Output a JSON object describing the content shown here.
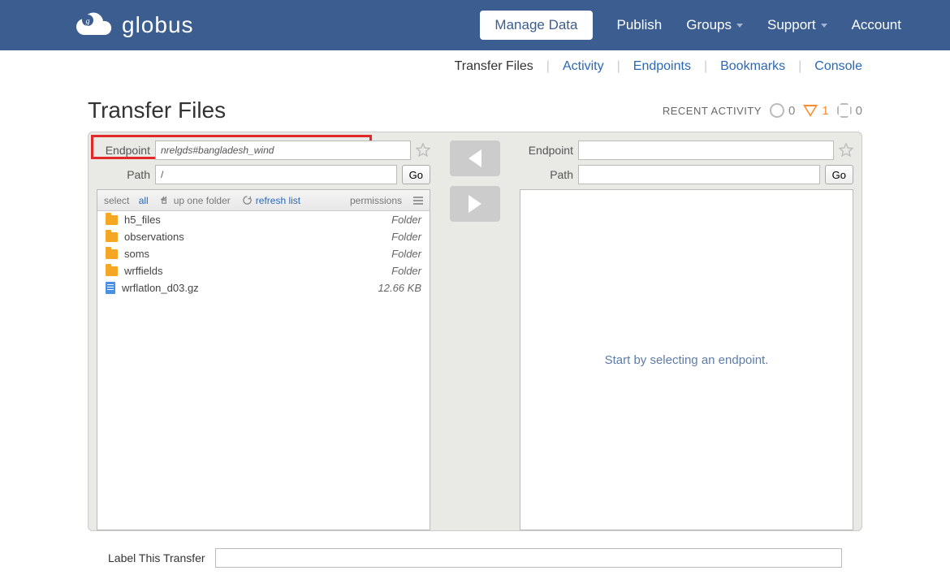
{
  "brand": "globus",
  "nav": {
    "manage_data": "Manage Data",
    "publish": "Publish",
    "groups": "Groups",
    "support": "Support",
    "account": "Account"
  },
  "subnav": {
    "transfer_files": "Transfer Files",
    "activity": "Activity",
    "endpoints": "Endpoints",
    "bookmarks": "Bookmarks",
    "console": "Console"
  },
  "page_title": "Transfer Files",
  "recent": {
    "label": "RECENT ACTIVITY",
    "ok": "0",
    "warn": "1",
    "stop": "0"
  },
  "labels": {
    "endpoint": "Endpoint",
    "path": "Path",
    "go": "Go",
    "select": "select",
    "all": "all",
    "up_one_folder": "up one folder",
    "refresh_list": "refresh list",
    "permissions": "permissions",
    "label_transfer": "Label This Transfer",
    "empty_right": "Start by selecting an endpoint."
  },
  "left": {
    "endpoint": "nrelgds#bangladesh_wind",
    "path": "/",
    "files": [
      {
        "name": "h5_files",
        "type": "folder",
        "meta": "Folder"
      },
      {
        "name": "observations",
        "type": "folder",
        "meta": "Folder"
      },
      {
        "name": "soms",
        "type": "folder",
        "meta": "Folder"
      },
      {
        "name": "wrffields",
        "type": "folder",
        "meta": "Folder"
      },
      {
        "name": "wrflatlon_d03.gz",
        "type": "file",
        "meta": "12.66 KB"
      }
    ]
  },
  "right": {
    "endpoint": "",
    "path": ""
  },
  "transfer_label_value": ""
}
